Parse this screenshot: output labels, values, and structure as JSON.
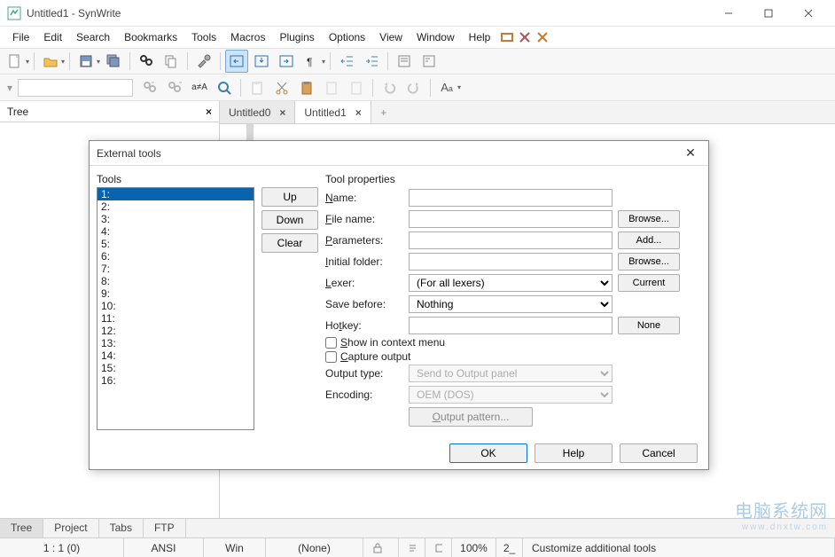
{
  "window": {
    "title": "Untitled1 - SynWrite"
  },
  "menu": [
    "File",
    "Edit",
    "Search",
    "Bookmarks",
    "Tools",
    "Macros",
    "Plugins",
    "Options",
    "View",
    "Window",
    "Help"
  ],
  "side_panel": {
    "label": "Tree"
  },
  "editor_tabs": [
    {
      "label": "Untitled0",
      "active": false
    },
    {
      "label": "Untitled1",
      "active": true
    }
  ],
  "bottom_tabs": [
    "Tree",
    "Project",
    "Tabs",
    "FTP"
  ],
  "statusbar": {
    "pos": "1 : 1 (0)",
    "enc": "ANSI",
    "eol": "Win",
    "lexer": "(None)",
    "zoom": "100%",
    "tab": "2_",
    "msg": "Customize additional tools"
  },
  "dialog": {
    "title": "External tools",
    "tools_label": "Tools",
    "props_label": "Tool properties",
    "list_items": [
      "1:",
      "2:",
      "3:",
      "4:",
      "5:",
      "6:",
      "7:",
      "8:",
      "9:",
      "10:",
      "11:",
      "12:",
      "13:",
      "14:",
      "15:",
      "16:"
    ],
    "selected_index": 0,
    "btns": {
      "up": "Up",
      "down": "Down",
      "clear": "Clear"
    },
    "labels": {
      "name": "Name:",
      "file": "File name:",
      "params": "Parameters:",
      "folder": "Initial folder:",
      "lexer": "Lexer:",
      "save": "Save before:",
      "hotkey": "Hotkey:",
      "otype": "Output type:",
      "enc": "Encoding:"
    },
    "side": {
      "browse": "Browse...",
      "add": "Add...",
      "current": "Current",
      "none": "None"
    },
    "values": {
      "name": "",
      "file": "",
      "params": "",
      "folder": "",
      "lexer": "(For all lexers)",
      "save": "Nothing",
      "hotkey": "",
      "otype": "Send to Output panel",
      "enc": "OEM (DOS)"
    },
    "checks": {
      "ctx": "Show in context menu",
      "cap": "Capture output"
    },
    "output_pattern": "Output pattern...",
    "footer": {
      "ok": "OK",
      "help": "Help",
      "cancel": "Cancel"
    }
  },
  "watermark": {
    "big": "电脑系统网",
    "small": "www.dnxtw.com"
  }
}
